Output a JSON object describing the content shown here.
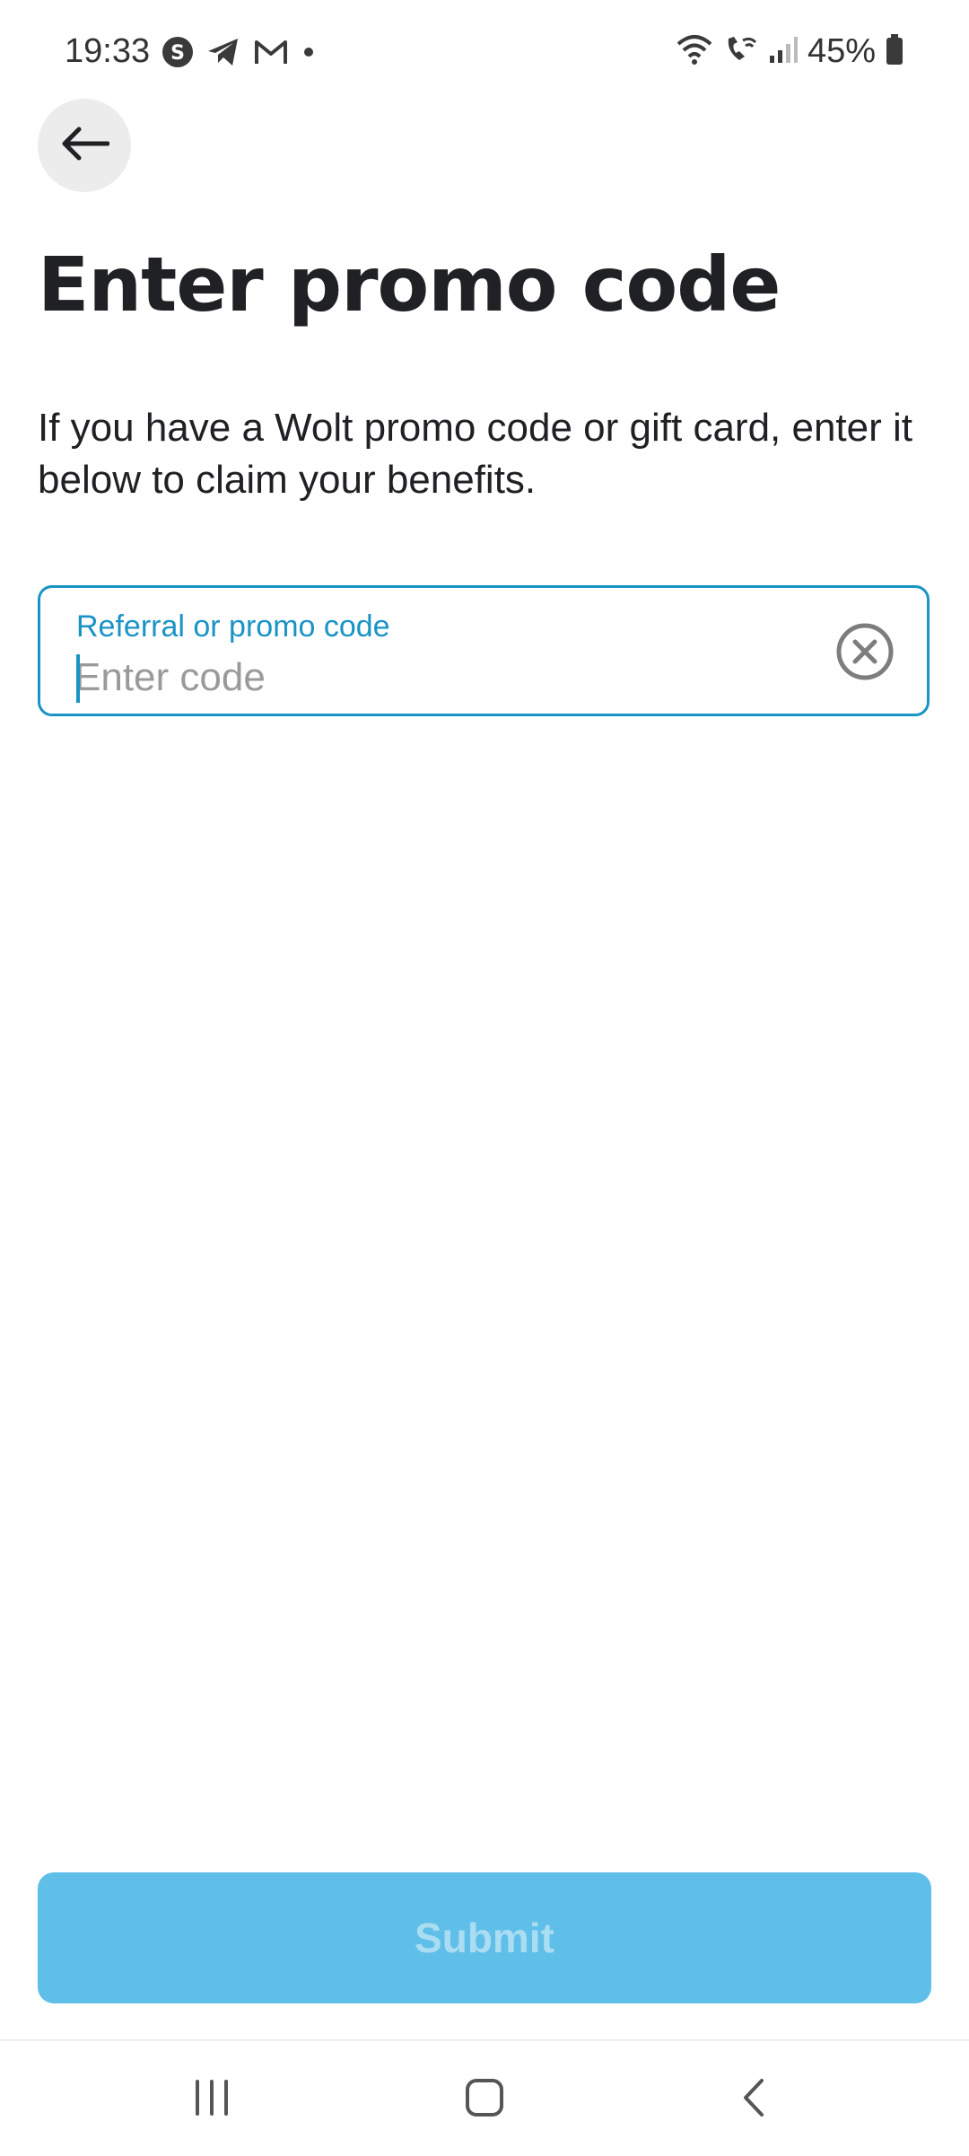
{
  "status_bar": {
    "time": "19:33",
    "battery": "45%",
    "left_icons": [
      "s-app-icon",
      "telegram-icon",
      "gmail-icon",
      "dot-icon"
    ],
    "right_icons": [
      "wifi-icon",
      "wifi-call-icon",
      "signal-icon",
      "battery-icon"
    ]
  },
  "header": {
    "back_icon": "arrow-left-icon"
  },
  "main": {
    "title": "Enter promo code",
    "description": "If you have a Wolt promo code or gift card, enter it below to claim your benefits.",
    "promo_field": {
      "label": "Referral or promo code",
      "value": "",
      "placeholder": "Enter code",
      "clear_icon": "clear-circle-icon"
    }
  },
  "footer": {
    "submit_label": "Submit"
  },
  "colors": {
    "accent": "#1a93c5",
    "submit_bg": "#5fbfe8",
    "submit_text": "#aadcf2",
    "back_bg": "#ececec"
  }
}
